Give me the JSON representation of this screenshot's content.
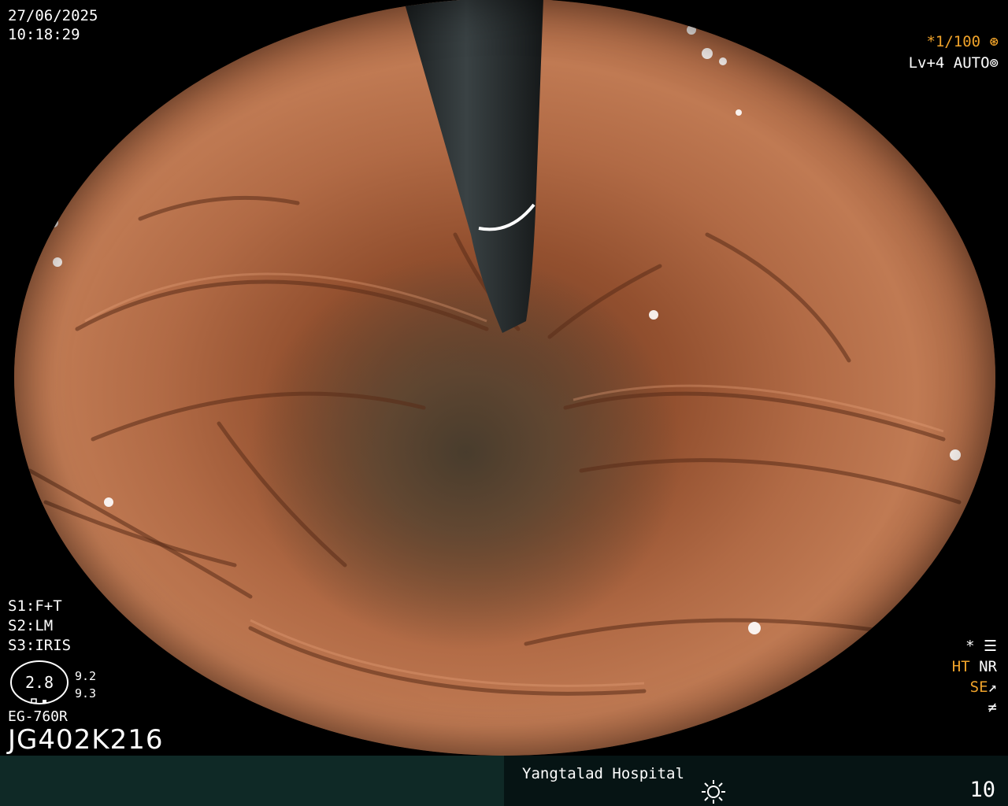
{
  "overlay": {
    "date": "27/06/2025",
    "time": "10:18:29",
    "shutter": "*1/100",
    "level": "Lv+4",
    "mode": "AUTO",
    "s1": "S1:F+T",
    "s2": "S2:LM",
    "s3": "S3:IRIS",
    "iris_value": "2.8",
    "iris_side_1": "9.2",
    "iris_side_2": "9.3",
    "scope_model": "EG-760R",
    "serial": "JG402K216",
    "flag_star": "*",
    "flag_ht": "HT",
    "flag_nr": "NR",
    "flag_se": "SE",
    "flag_sym": "≠"
  },
  "footer": {
    "hospital": "Yangtalad Hospital",
    "page_number": "10"
  },
  "colors": {
    "orange": "#f0a32a",
    "bar_left": "#0f2926",
    "bar_right": "#061414"
  },
  "icons": [
    "aperture-icon",
    "auto-iris-icon",
    "settings-sliders-icon",
    "se-arrow-icon",
    "brightness-icon",
    "iris-dial-icon"
  ]
}
